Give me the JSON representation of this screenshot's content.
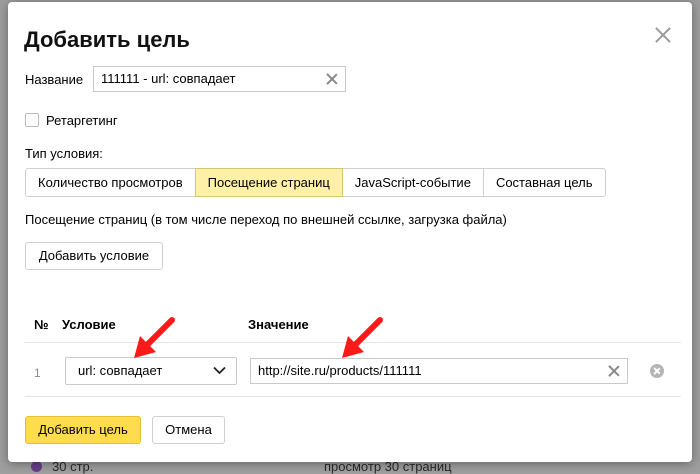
{
  "background": {
    "bottom_left": "30 стр.",
    "bottom_right": "просмотр 30 страниц"
  },
  "modal": {
    "title": "Добавить цель",
    "name_label": "Название",
    "name_value": "111111 - url: совпадает",
    "retargeting_label": "Ретаргетинг",
    "retargeting_checked": false,
    "condition_type_label": "Тип условия:",
    "tabs": [
      {
        "label": "Количество просмотров",
        "active": false
      },
      {
        "label": "Посещение страниц",
        "active": true
      },
      {
        "label": "JavaScript-событие",
        "active": false
      },
      {
        "label": "Составная цель",
        "active": false
      }
    ],
    "description": "Посещение страниц (в том числе переход по внешней ссылке, загрузка файла)",
    "add_condition_label": "Добавить условие",
    "table": {
      "headers": {
        "num": "№",
        "condition": "Условие",
        "value": "Значение"
      },
      "rows": [
        {
          "num": "1",
          "condition": "url: совпадает",
          "value": "http://site.ru/products/111111"
        }
      ]
    },
    "add_goal_label": "Добавить цель",
    "cancel_label": "Отмена"
  },
  "colors": {
    "accent": "#ffdb4d",
    "active_tab": "#fff0a8",
    "annotation_arrow": "#ff1a1a"
  },
  "icons": {
    "close": "close-icon",
    "clear": "clear-icon",
    "dropdown": "chevron-down-icon",
    "remove": "remove-circle-icon",
    "annotation": "red-arrow-icon"
  }
}
